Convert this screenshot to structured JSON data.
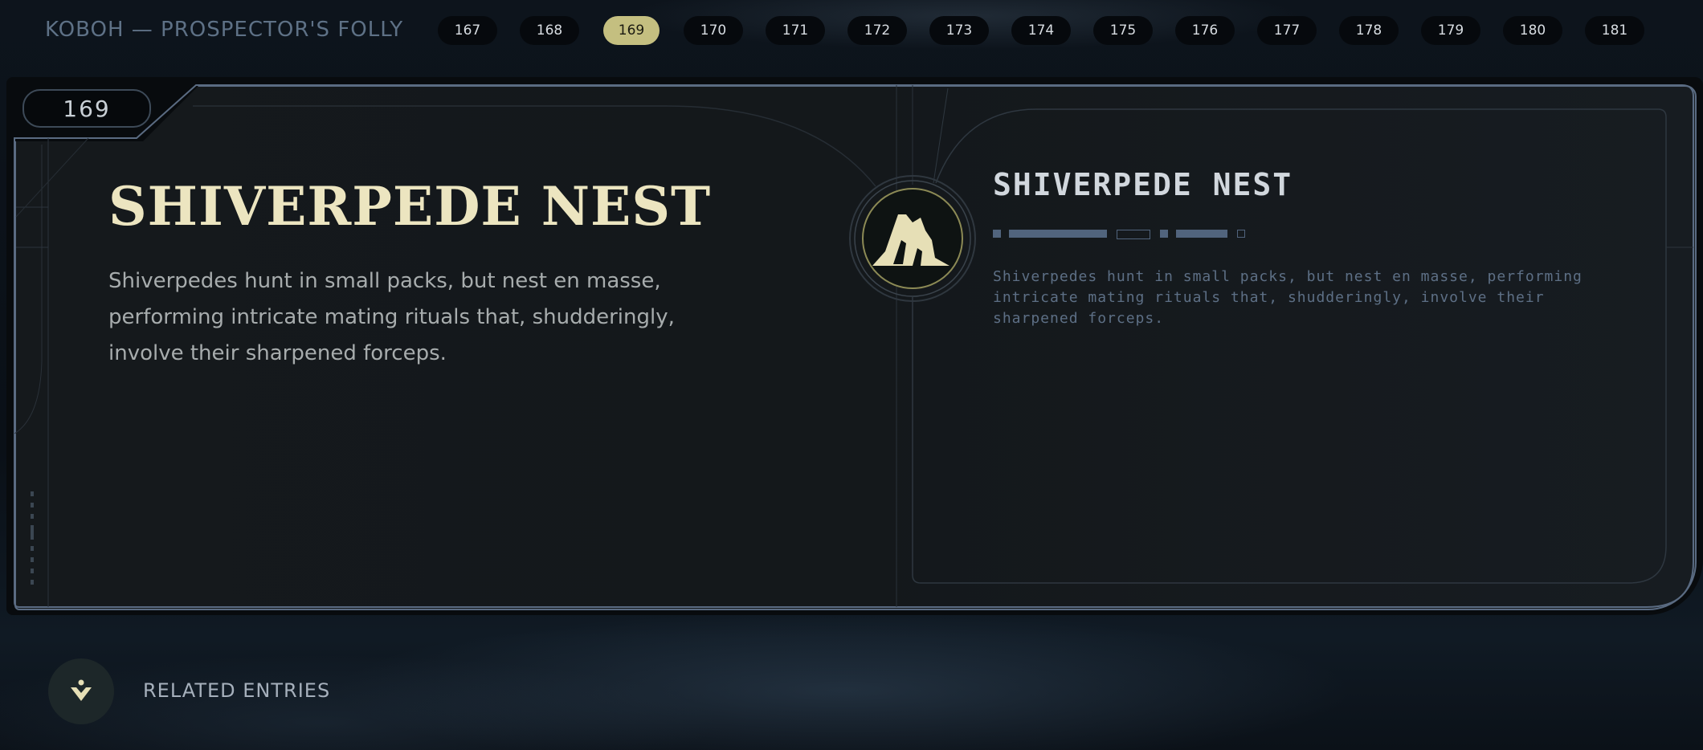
{
  "location": "KOBOH — PROSPECTOR'S FOLLY",
  "pager": {
    "pages": [
      "167",
      "168",
      "169",
      "170",
      "171",
      "172",
      "173",
      "174",
      "175",
      "176",
      "177",
      "178",
      "179",
      "180",
      "181"
    ],
    "active": "169"
  },
  "entry": {
    "number": "169",
    "title": "SHIVERPEDE NEST",
    "description": "Shiverpedes hunt in small packs, but nest en masse, performing intricate mating rituals that, shudderingly, involve their sharpened forceps.",
    "aurebesh_title": "SHIVERPEDE NEST",
    "aurebesh_text": "Shiverpedes hunt in small packs, but nest en masse, performing intricate mating rituals that, shudderingly, involve their sharpened forceps."
  },
  "icons": {
    "entry_emblem": "mountain-icon",
    "related": "person-down-icon"
  },
  "related": {
    "label": "RELATED ENTRIES"
  },
  "colors": {
    "accent": "#c4bf80",
    "title": "#ece5c0",
    "frame": "#5a6b82",
    "aurebesh": "#5d6f85"
  }
}
